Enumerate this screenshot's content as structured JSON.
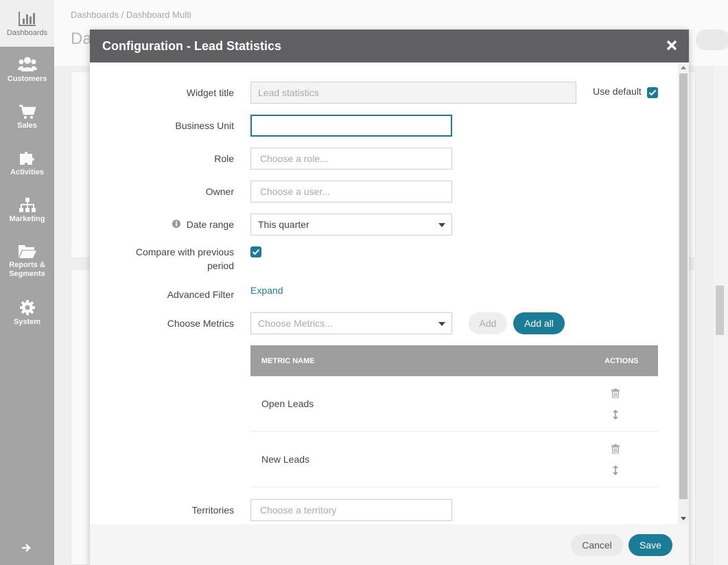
{
  "sidebar": {
    "items": [
      {
        "label": "Dashboards",
        "icon": "bar-chart-icon"
      },
      {
        "label": "Customers",
        "icon": "users-icon"
      },
      {
        "label": "Sales",
        "icon": "cart-icon"
      },
      {
        "label": "Activities",
        "icon": "puzzle-icon"
      },
      {
        "label": "Marketing",
        "icon": "sitemap-icon"
      },
      {
        "label_line1": "Reports &",
        "label_line2": "Segments",
        "icon": "folder-icon"
      },
      {
        "label": "System",
        "icon": "gear-icon"
      }
    ]
  },
  "page": {
    "breadcrumb": "Dashboards / Dashboard Multi",
    "title_fragment": "Da"
  },
  "modal": {
    "title": "Configuration - Lead Statistics",
    "fields": {
      "widget_title_label": "Widget title",
      "widget_title_value": "Lead statistics",
      "use_default_label": "Use default",
      "business_unit_label": "Business Unit",
      "role_label": "Role",
      "role_placeholder": "Choose a role...",
      "owner_label": "Owner",
      "owner_placeholder": "Choose a user...",
      "date_range_label": "Date range",
      "date_range_value": "This quarter",
      "compare_label_line1": "Compare with previous",
      "compare_label_line2": "period",
      "advanced_filter_label": "Advanced Filter",
      "advanced_filter_link": "Expand",
      "choose_metrics_label": "Choose Metrics",
      "choose_metrics_placeholder": "Choose Metrics...",
      "add_button": "Add",
      "add_all_button": "Add all",
      "territories_label": "Territories",
      "territories_placeholder": "Choose a territory"
    },
    "metrics_table": {
      "headers": {
        "name": "METRIC NAME",
        "actions": "ACTIONS"
      },
      "rows": [
        {
          "name": "Open Leads"
        },
        {
          "name": "New Leads"
        }
      ]
    },
    "footer": {
      "cancel": "Cancel",
      "save": "Save"
    }
  },
  "colors": {
    "accent": "#1b7c98",
    "header": "#606062",
    "sidebar": "#a8a8a8"
  }
}
